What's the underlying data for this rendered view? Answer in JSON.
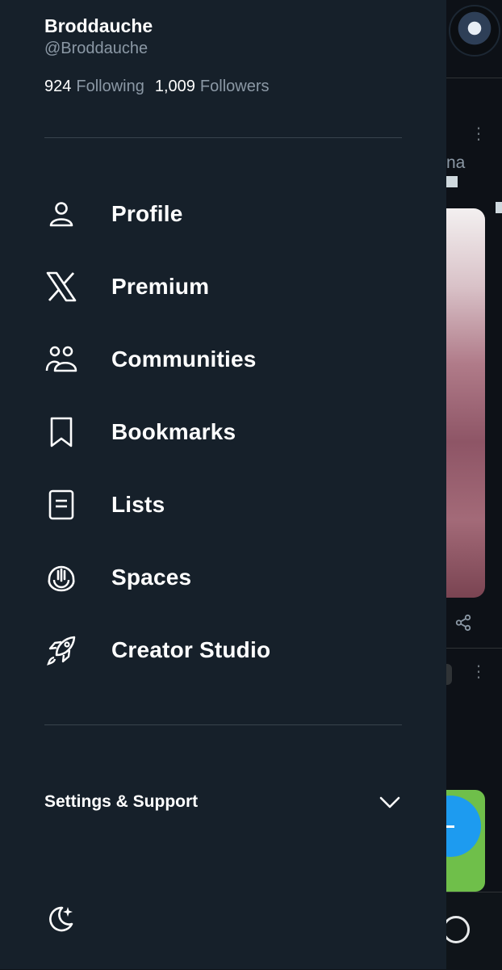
{
  "profile": {
    "name": "Broddauche",
    "handle": "@Broddauche",
    "following_count": "924",
    "following_label": "Following",
    "followers_count": "1,009",
    "followers_label": "Followers"
  },
  "menu": [
    {
      "label": "Profile",
      "icon": "person-icon"
    },
    {
      "label": "Premium",
      "icon": "x-logo-icon"
    },
    {
      "label": "Communities",
      "icon": "communities-icon"
    },
    {
      "label": "Bookmarks",
      "icon": "bookmark-icon"
    },
    {
      "label": "Lists",
      "icon": "list-icon"
    },
    {
      "label": "Spaces",
      "icon": "spaces-icon"
    },
    {
      "label": "Creator Studio",
      "icon": "rocket-icon"
    }
  ],
  "settings": {
    "label": "Settings & Support"
  },
  "background_feed": {
    "partial_text": "na"
  },
  "colors": {
    "drawer": "#16202a",
    "text": "#ffffff",
    "muted": "#8b98a5",
    "accent": "#1d9bf0"
  }
}
